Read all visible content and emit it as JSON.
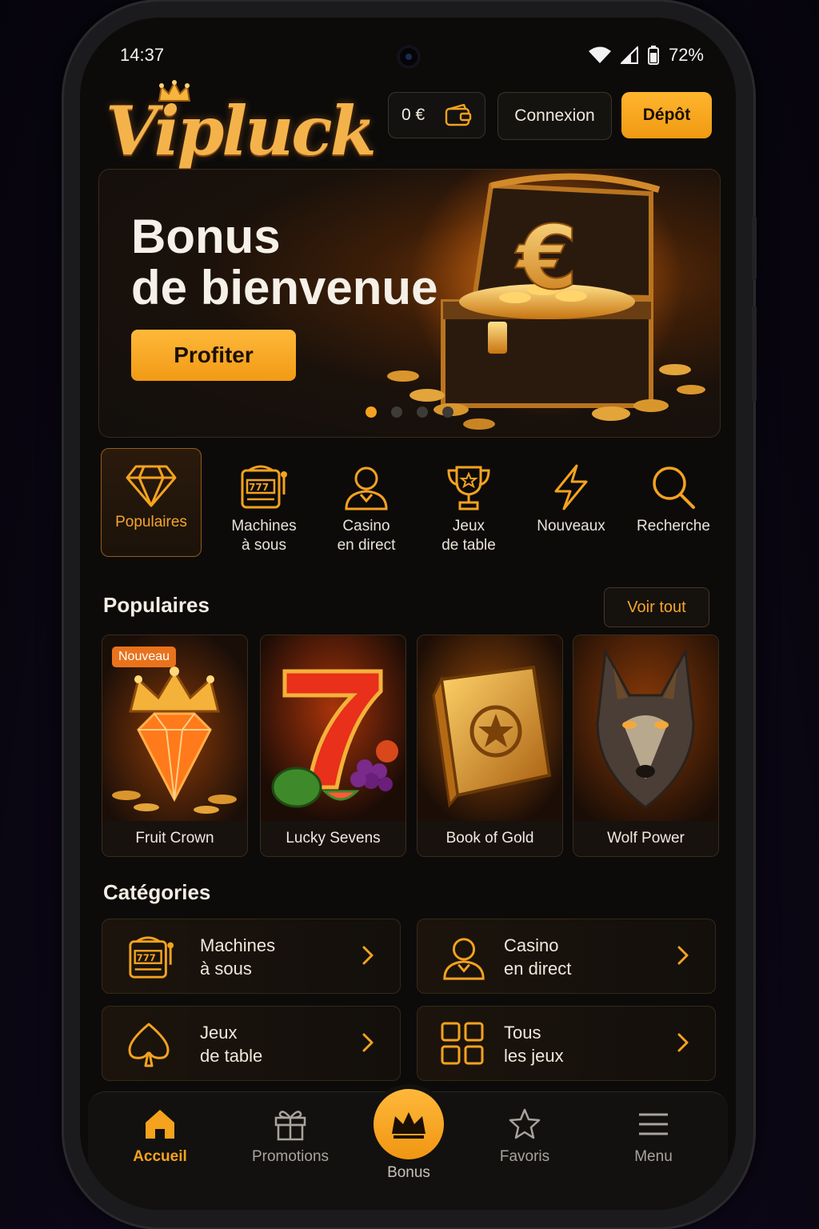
{
  "status_bar": {
    "time": "14:37",
    "battery": "72%"
  },
  "header": {
    "logo_text": "Vipluck",
    "wallet_balance": "0 €",
    "login_label": "Connexion",
    "deposit_label": "Dépôt"
  },
  "banner": {
    "title_line1": "Bonus",
    "title_line2": "de bienvenue",
    "cta_label": "Profiter",
    "slide_count": 4,
    "active_slide": 1
  },
  "quick_categories": [
    {
      "icon": "diamond-icon",
      "line1": "Populaires",
      "line2": "",
      "active": true
    },
    {
      "icon": "slot-machine-icon",
      "line1": "Machines",
      "line2": "à sous",
      "active": false
    },
    {
      "icon": "dealer-icon",
      "line1": "Casino",
      "line2": "en direct",
      "active": false
    },
    {
      "icon": "trophy-icon",
      "line1": "Jeux",
      "line2": "de table",
      "active": false
    },
    {
      "icon": "lightning-icon",
      "line1": "Nouveaux",
      "line2": "",
      "active": false
    },
    {
      "icon": "search-icon",
      "line1": "Recherche",
      "line2": "",
      "active": false
    }
  ],
  "popular": {
    "title": "Populaires",
    "see_all_label": "Voir tout",
    "games": [
      {
        "name": "Fruit Crown",
        "badge": "Nouveau",
        "art": "crown-diamond"
      },
      {
        "name": "Lucky Sevens",
        "badge": "",
        "art": "seven-fruits"
      },
      {
        "name": "Book of Gold",
        "badge": "",
        "art": "golden-book"
      },
      {
        "name": "Wolf Power",
        "badge": "",
        "art": "wolf"
      }
    ]
  },
  "categories": {
    "title": "Catégories",
    "items": [
      {
        "icon": "slot-machine-icon",
        "line1": "Machines",
        "line2": "à sous"
      },
      {
        "icon": "dealer-icon",
        "line1": "Casino",
        "line2": "en direct"
      },
      {
        "icon": "spade-icon",
        "line1": "Jeux",
        "line2": "de table"
      },
      {
        "icon": "grid-icon",
        "line1": "Tous",
        "line2": "les jeux"
      }
    ]
  },
  "bottom_nav": [
    {
      "icon": "home-icon",
      "label": "Accueil",
      "active": true
    },
    {
      "icon": "gift-icon",
      "label": "Promotions",
      "active": false
    },
    {
      "icon": "crown-icon",
      "label": "Bonus",
      "active": false
    },
    {
      "icon": "star-icon",
      "label": "Favoris",
      "active": false
    },
    {
      "icon": "menu-icon",
      "label": "Menu",
      "active": false
    }
  ],
  "colors": {
    "accent": "#f5a21f",
    "background": "#0c0b0a",
    "card_border": "#3a2c1c"
  }
}
